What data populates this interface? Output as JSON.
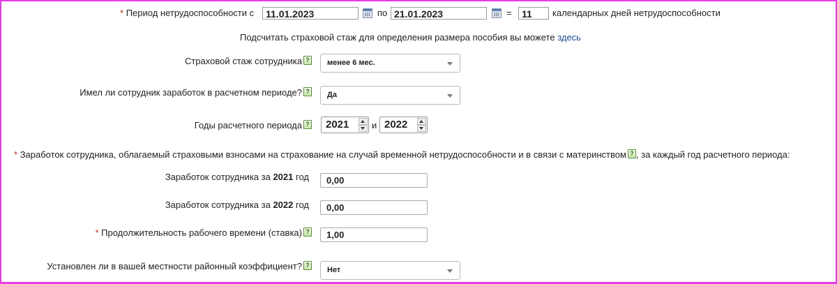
{
  "period": {
    "label": "Период нетрудоспособности с",
    "from": "11.01.2023",
    "to_label": "по",
    "to": "21.01.2023",
    "equals": "=",
    "days": "11",
    "days_suffix": "календарных дней нетрудоспособности"
  },
  "stazh_note": {
    "text": "Подсчитать страховой стаж для определения размера пособия вы можете",
    "link": "здесь"
  },
  "insurance_stazh": {
    "label": "Страховой стаж сотрудника",
    "value": "менее 6 мес."
  },
  "had_earnings": {
    "label": "Имел ли сотрудник заработок в расчетном периоде?",
    "value": "Да"
  },
  "calc_years": {
    "label": "Годы расчетного периода",
    "year1": "2021",
    "and": "и",
    "year2": "2022"
  },
  "earnings_heading": {
    "text": "Заработок сотрудника, облагаемый страховыми взносами на страхование на случай временной нетрудоспособности и в связи с материнством",
    "suffix": ", за каждый год расчетного периода:"
  },
  "earnings": [
    {
      "prefix": "Заработок сотрудника за",
      "year": "2021",
      "suffix": "год",
      "value": "0,00"
    },
    {
      "prefix": "Заработок сотрудника за",
      "year": "2022",
      "suffix": "год",
      "value": "0,00"
    }
  ],
  "work_time": {
    "label": "Продолжительность рабочего времени (ставка)",
    "value": "1,00"
  },
  "regional_coef": {
    "label": "Установлен ли в вашей местности районный коэффициент?",
    "value": "Нет"
  },
  "common": {
    "required_mark": "*",
    "help_glyph": "?"
  },
  "colors": {
    "frame": "#e63ce6",
    "required": "#d9261c",
    "link": "#1a4fa3"
  }
}
